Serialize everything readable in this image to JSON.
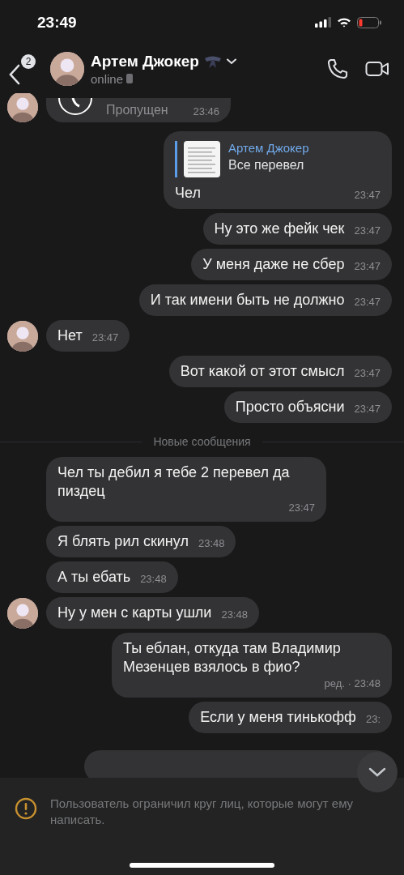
{
  "status_bar": {
    "time": "23:49"
  },
  "header": {
    "back_badge": "2",
    "name": "Артем Джокер",
    "status": "online"
  },
  "messages": [
    {
      "kind": "call",
      "outgoing": false,
      "avatar": true,
      "text": "Пропущен",
      "time": "23:46"
    },
    {
      "kind": "reply",
      "outgoing": true,
      "avatar": false,
      "reply_author": "Артем Джокер",
      "reply_text": "Все перевел",
      "text": "Чел",
      "time": "23:47"
    },
    {
      "kind": "text",
      "outgoing": true,
      "avatar": false,
      "text": "Ну это же фейк чек",
      "time": "23:47"
    },
    {
      "kind": "text",
      "outgoing": true,
      "avatar": false,
      "text": "У меня даже не сбер",
      "time": "23:47"
    },
    {
      "kind": "text",
      "outgoing": true,
      "avatar": false,
      "text": "И так имени быть не должно",
      "time": "23:47"
    },
    {
      "kind": "text",
      "outgoing": false,
      "avatar": true,
      "text": "Нет",
      "time": "23:47"
    },
    {
      "kind": "text",
      "outgoing": true,
      "avatar": false,
      "text": "Вот какой от этот смысл",
      "time": "23:47"
    },
    {
      "kind": "text",
      "outgoing": true,
      "avatar": false,
      "text": "Просто объясни",
      "time": "23:47"
    },
    {
      "kind": "divider",
      "text": "Новые сообщения"
    },
    {
      "kind": "text",
      "outgoing": false,
      "avatar": false,
      "text": "Чел ты дебил я тебе 2 перевел да пиздец",
      "time": "23:47"
    },
    {
      "kind": "text",
      "outgoing": false,
      "avatar": false,
      "text": "Я блять рил скинул",
      "time": "23:48"
    },
    {
      "kind": "text",
      "outgoing": false,
      "avatar": false,
      "text": "А ты ебать",
      "time": "23:48"
    },
    {
      "kind": "text",
      "outgoing": false,
      "avatar": true,
      "text": "Ну у мен с карты ушли",
      "time": "23:48"
    },
    {
      "kind": "text",
      "outgoing": true,
      "avatar": false,
      "text": "Ты еблан, откуда там Владимир Мезенцев взялось в фио?",
      "time": "ред. · 23:48"
    },
    {
      "kind": "text",
      "outgoing": true,
      "avatar": false,
      "text": "Если у меня тинькофф",
      "time": "23:"
    },
    {
      "kind": "stub",
      "outgoing": true
    }
  ],
  "notice": {
    "text": "Пользователь ограничил круг лиц, которые могут ему написать."
  }
}
